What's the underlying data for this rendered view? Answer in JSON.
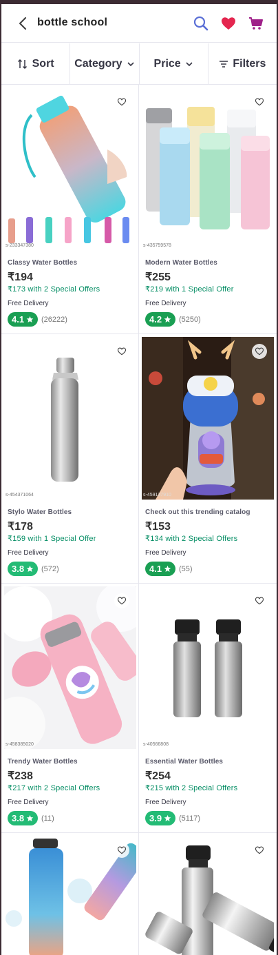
{
  "header": {
    "search_query": "bottle school"
  },
  "filters": {
    "sort": "Sort",
    "category": "Category",
    "price": "Price",
    "filters": "Filters"
  },
  "colors": {
    "accent": "#9f2089",
    "rating_green": "#23bb75",
    "offer_green": "#038d63",
    "heart_red": "#e4264f",
    "search_blue": "#5a6fd6"
  },
  "products": [
    {
      "name": "Classy Water Bottles",
      "price": "₹194",
      "offer": "₹173 with 2 Special Offers",
      "delivery": "Free Delivery",
      "rating": "4.1",
      "reviews": "(26222)",
      "sku": "s-233347380"
    },
    {
      "name": "Modern Water Bottles",
      "price": "₹255",
      "offer": "₹219 with 1 Special Offer",
      "delivery": "Free Delivery",
      "rating": "4.2",
      "reviews": "(5250)",
      "sku": "s-435759578"
    },
    {
      "name": "Stylo Water Bottles",
      "price": "₹178",
      "offer": "₹159 with 1 Special Offer",
      "delivery": "Free Delivery",
      "rating": "3.8",
      "reviews": "(572)",
      "sku": "s-454371064"
    },
    {
      "name": "Check out this trending catalog",
      "price": "₹153",
      "offer": "₹134 with 2 Special Offers",
      "delivery": "Free Delivery",
      "rating": "4.1",
      "reviews": "(55)",
      "sku": "s-459137910"
    },
    {
      "name": "Trendy Water Bottles",
      "price": "₹238",
      "offer": "₹217 with 2 Special Offers",
      "delivery": "Free Delivery",
      "rating": "3.8",
      "reviews": "(11)",
      "sku": "s-458385020"
    },
    {
      "name": "Essential Water Bottles",
      "price": "₹254",
      "offer": "₹215 with 2 Special Offers",
      "delivery": "Free Delivery",
      "rating": "3.9",
      "reviews": "(5117)",
      "sku": "s-40566808"
    }
  ]
}
